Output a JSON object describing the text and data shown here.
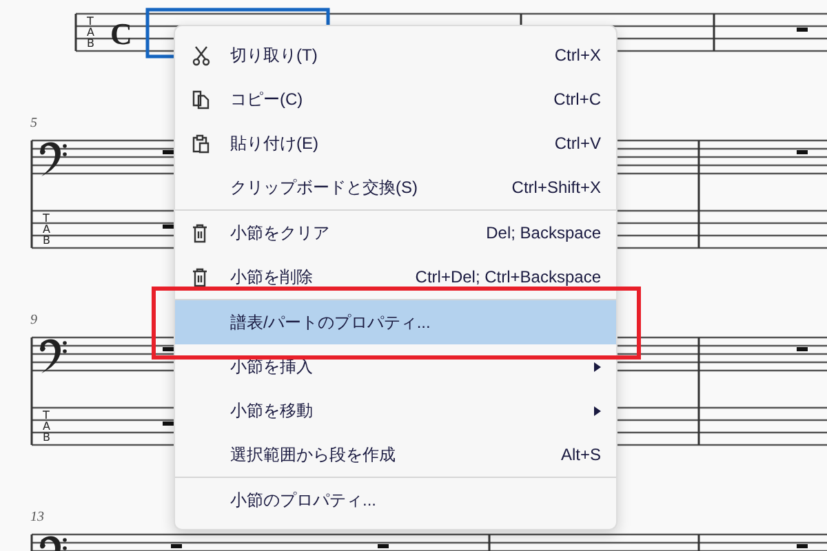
{
  "score": {
    "systems": [
      {
        "bass_staff": false,
        "tab_staff": true,
        "time_signature": "C",
        "selected": true,
        "tab_letters": [
          "T",
          "A",
          "B"
        ]
      },
      {
        "measure_number": "5",
        "bass_staff": true,
        "tab_staff": true,
        "selected": false,
        "tab_letters": [
          "T",
          "A",
          "B"
        ]
      },
      {
        "measure_number": "9",
        "bass_staff": true,
        "tab_staff": true,
        "selected": false,
        "tab_letters": [
          "T",
          "A",
          "B"
        ]
      },
      {
        "measure_number": "13",
        "bass_staff": true,
        "tab_staff": false,
        "selected": false
      }
    ]
  },
  "context_menu": {
    "items": [
      {
        "kind": "cut",
        "label": "切り取り(T)",
        "shortcut": "Ctrl+X",
        "selected": false
      },
      {
        "kind": "copy",
        "label": "コピー(C)",
        "shortcut": "Ctrl+C",
        "selected": false
      },
      {
        "kind": "paste",
        "label": "貼り付け(E)",
        "shortcut": "Ctrl+V",
        "selected": false
      },
      {
        "kind": "plain",
        "label": "クリップボードと交換(S)",
        "shortcut": "Ctrl+Shift+X",
        "selected": false
      },
      {
        "kind": "separator"
      },
      {
        "kind": "trash",
        "label": "小節をクリア",
        "shortcut": "Del; Backspace",
        "selected": false
      },
      {
        "kind": "trash",
        "label": "小節を削除",
        "shortcut": "Ctrl+Del; Ctrl+Backspace",
        "selected": false
      },
      {
        "kind": "separator"
      },
      {
        "kind": "plain",
        "label": "譜表/パートのプロパティ...",
        "selected": true,
        "annotated": true
      },
      {
        "kind": "plain",
        "label": "小節を挿入",
        "submenu": true,
        "selected": false
      },
      {
        "kind": "plain",
        "label": "小節を移動",
        "submenu": true,
        "selected": false
      },
      {
        "kind": "plain",
        "label": "選択範囲から段を作成",
        "shortcut": "Alt+S",
        "selected": false
      },
      {
        "kind": "separator"
      },
      {
        "kind": "plain",
        "label": "小節のプロパティ...",
        "selected": false
      }
    ]
  }
}
